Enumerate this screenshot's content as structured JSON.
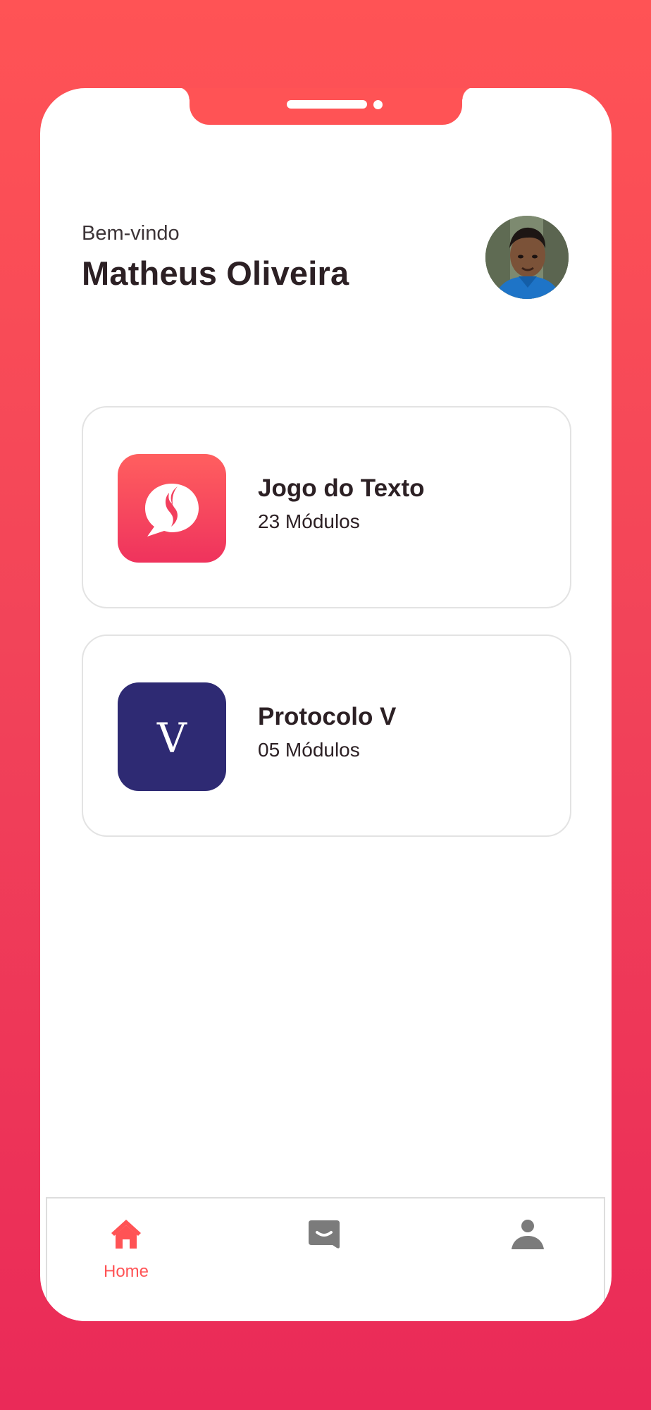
{
  "header": {
    "greeting": "Bem-vindo",
    "user_name": "Matheus Oliveira"
  },
  "courses": [
    {
      "title": "Jogo do Texto",
      "subtitle": "23 Módulos",
      "icon": "chat-bubble-flame-icon",
      "color": "#f23f5d"
    },
    {
      "title": "Protocolo V",
      "subtitle": "05 Módulos",
      "icon_letter": "V",
      "icon": "letter-v-icon",
      "color": "#2e2a73"
    }
  ],
  "nav": {
    "items": [
      {
        "label": "Home",
        "icon": "home-icon",
        "active": true
      },
      {
        "label": "",
        "icon": "message-icon",
        "active": false
      },
      {
        "label": "",
        "icon": "profile-icon",
        "active": false
      }
    ],
    "active_color": "#ff5355",
    "inactive_color": "#7b7b7b"
  },
  "theme": {
    "background_top": "#ff5355",
    "background_bottom": "#ea2a58"
  }
}
